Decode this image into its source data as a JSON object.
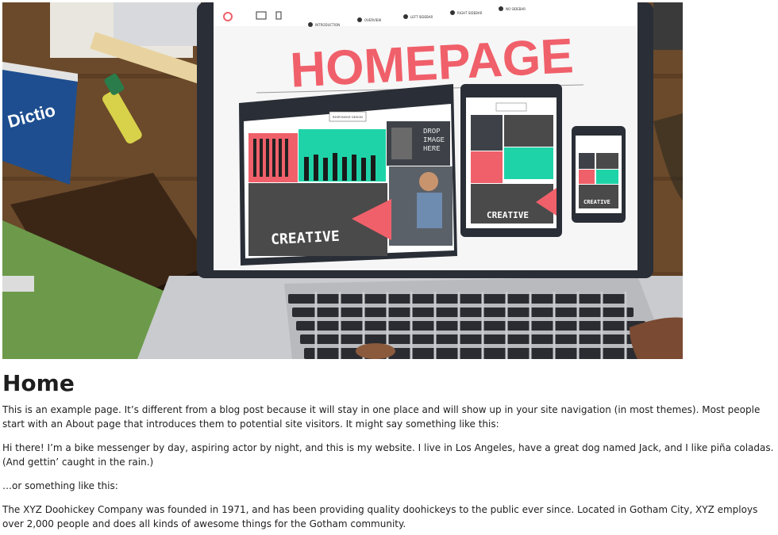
{
  "hero": {
    "screen_heading": "HOMEPAGE",
    "screen_nav": [
      "INTRODUCTION",
      "OVERVIEW",
      "LEFT SIDEBAR",
      "RIGHT SIDEBAR",
      "NO SIDEBAR"
    ],
    "device_label": "RESPONSIVE DESIGN",
    "creative_label": "CREATIVE",
    "drop_image_label": [
      "DROP",
      "IMAGE",
      "HERE"
    ],
    "dictionary_text": "Dictio"
  },
  "page": {
    "title": "Home",
    "paragraphs": [
      "This is an example page. It’s different from a blog post because it will stay in one place and will show up in your site navigation (in most themes). Most people start with an About page that introduces them to potential site visitors. It might say something like this:",
      "Hi there! I’m a bike messenger by day, aspiring actor by night, and this is my website. I live in Los Angeles, have a great dog named Jack, and I like piña coladas. (And gettin’ caught in the rain.)",
      "…or something like this:",
      "The XYZ Doohickey Company was founded in 1971, and has been providing quality doohickeys to the public ever since. Located in Gotham City, XYZ employs over 2,000 people and does all kinds of awesome things for the Gotham community."
    ]
  },
  "colors": {
    "accent_coral": "#f0606a",
    "accent_teal": "#1fd3a8",
    "laptop_dark": "#2a2e36"
  }
}
